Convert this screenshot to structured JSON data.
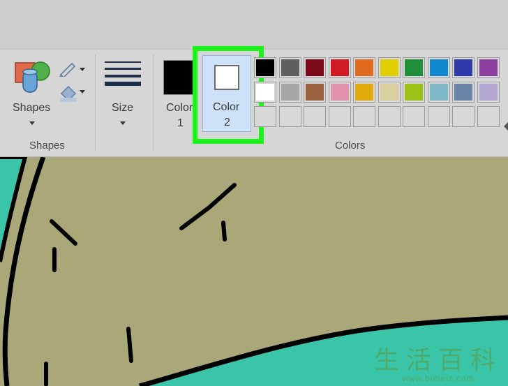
{
  "ribbon": {
    "shapes_button": "Shapes",
    "shapes_group": "Shapes",
    "size_button": "Size",
    "color1_line1": "Color",
    "color1_line2": "1",
    "color2_line1": "Color",
    "color2_line2": "2",
    "colors_group": "Colors"
  },
  "colors": {
    "color1": "#000000",
    "color2": "#ffffff",
    "highlight": "#1bf41b",
    "palette_row1": [
      "#000000",
      "#5f5f5f",
      "#7a0a1a",
      "#d21a24",
      "#e06a1e",
      "#e2cf00",
      "#1f8f3a",
      "#0f88cc",
      "#2f3aaa",
      "#8b3fa0"
    ],
    "palette_row2": [
      "#ffffff",
      "#a6a6a6",
      "#98603c",
      "#e193ae",
      "#e2a90c",
      "#d8cf9c",
      "#9cc21a",
      "#7fb9c9",
      "#6a83a9",
      "#b3a6d1"
    ],
    "canvas_ground": "#aaa778",
    "canvas_water": "#3ac4a8"
  },
  "watermark": {
    "chars": "生活百科",
    "url": "www.bimeiz.com"
  }
}
